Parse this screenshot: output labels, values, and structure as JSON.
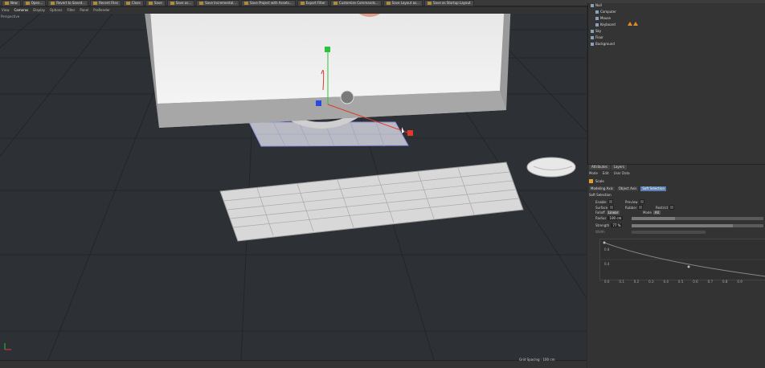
{
  "toolbar": {
    "items": [
      "New",
      "Open...",
      "Revert to Saved...",
      "Recent Files",
      "Close",
      "Save",
      "Save as...",
      "Save Incremental...",
      "Save Project with Assets...",
      "Export Filter",
      "Customize Commands...",
      "Save Layout as...",
      "Save as Startup Layout"
    ]
  },
  "viewport_menu": [
    "View",
    "Cameras",
    "Display",
    "Options",
    "Filter",
    "Panel",
    "ProRender"
  ],
  "viewport_label": "Perspective",
  "grid_spacing": "Grid Spacing : 100 cm",
  "objects": {
    "items": [
      "Null",
      "Computer",
      "Mouse",
      "Keyboard",
      "Sky",
      "Floor",
      "Background"
    ]
  },
  "attributes": {
    "tabs": [
      "Attributes",
      "Layers"
    ],
    "menu": [
      "Mode",
      "Edit",
      "User Data"
    ],
    "title": "Scale",
    "subtabs": [
      "Modeling Axis",
      "Object Axis",
      "Soft Selection"
    ],
    "section": "Soft Selection",
    "enable_label": "Enable",
    "preview_label": "Preview",
    "surface_label": "Surface",
    "rubber_label": "Rubber",
    "restrict_label": "Restrict",
    "falloff_label": "Falloff",
    "falloff_value": "Linear",
    "mode_label": "Mode",
    "mode_value": "All",
    "radius_label": "Radius",
    "radius_value": "100 cm",
    "strength_label": "Strength",
    "strength_value": "77 %",
    "width_label": "Width",
    "radius_fraction": 0.33,
    "strength_fraction": 0.77,
    "curve_x_ticks": [
      "0.0",
      "0.1",
      "0.2",
      "0.3",
      "0.4",
      "0.5",
      "0.6",
      "0.7",
      "0.8",
      "0.9"
    ],
    "curve_y_ticks": [
      "0.8",
      "0.4"
    ]
  },
  "colors": {
    "accent": "#5a7fb0",
    "axis_x": "#e03a2a",
    "axis_y": "#2ac43a",
    "axis_z": "#2a4ae0"
  }
}
